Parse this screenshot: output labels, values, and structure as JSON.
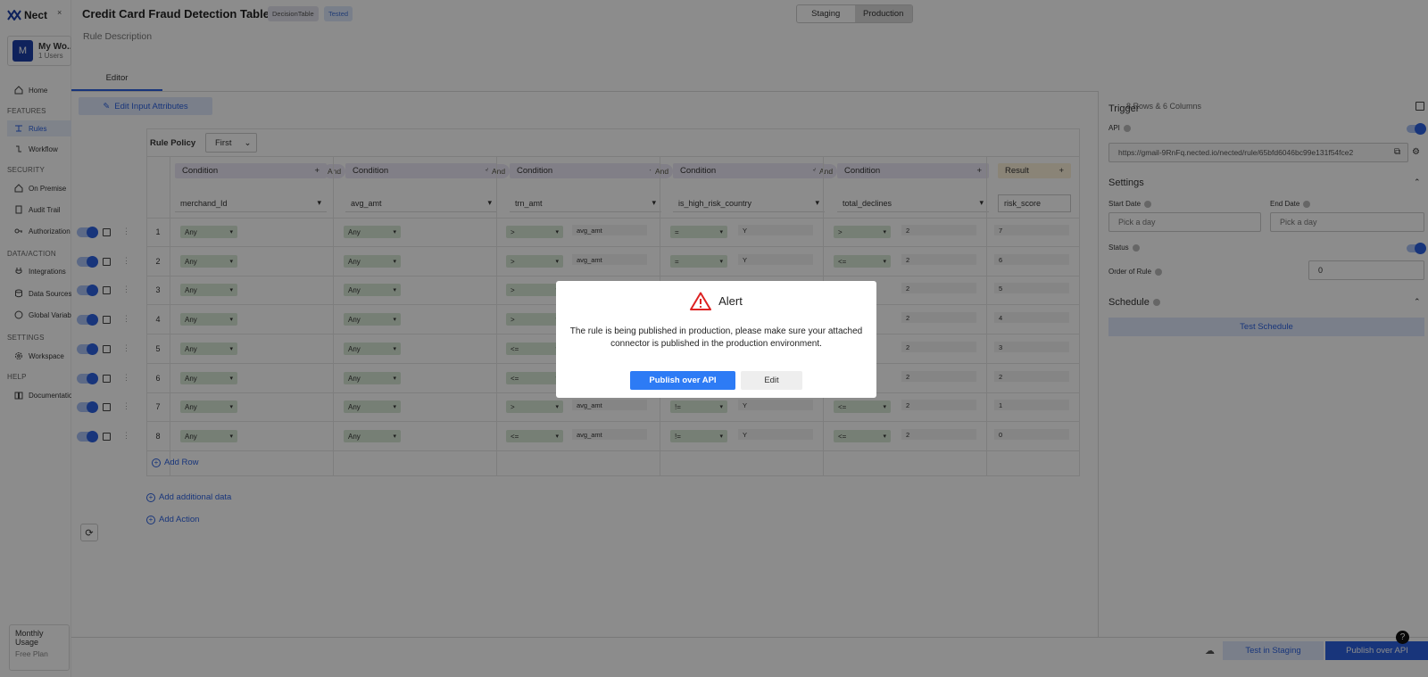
{
  "app": {
    "brand": "Nect",
    "close_tab": "×",
    "tab_mark": "ˆ"
  },
  "workspace": {
    "initial": "M",
    "name": "My Wo...",
    "users": "1 Users"
  },
  "sidebar": {
    "home": "Home",
    "sections": {
      "features": "FEATURES",
      "security": "SECURITY",
      "data_action": "DATA/ACTION",
      "settings": "SETTINGS",
      "help": "HELP"
    },
    "items": {
      "rules": "Rules",
      "workflow": "Workflow",
      "on_premise": "On Premise",
      "audit_trail": "Audit Trail",
      "authorization": "Authorization",
      "integrations": "Integrations",
      "data_sources": "Data Sources",
      "global_variables": "Global Variable",
      "workspace": "Workspace",
      "documentation": "Documentation"
    }
  },
  "usage": {
    "line1": "Monthly",
    "line2": "Usage",
    "plan": "Free Plan"
  },
  "header": {
    "title": "Credit Card Fraud Detection Table",
    "badge_type": "DecisionTable",
    "badge_status": "Tested",
    "description": "Rule Description",
    "env_staging": "Staging",
    "env_production": "Production"
  },
  "tabs": {
    "editor": "Editor"
  },
  "editor": {
    "edit_attrs": "Edit Input Attributes",
    "rule_policy_label": "Rule Policy",
    "rule_policy_value": "First",
    "condition_label": "Condition",
    "result_label": "Result",
    "and_label": "And",
    "plus": "+",
    "attributes": [
      "merchand_Id",
      "avg_amt",
      "trn_amt",
      "is_high_risk_country",
      "total_declines"
    ],
    "result_attr": "risk_score",
    "any": "Any",
    "avg_amt_val": "avg_amt",
    "rows": [
      {
        "n": "1",
        "op3": ">",
        "op4": "=",
        "v4": "Y",
        "op5": ">",
        "v5": "2",
        "r": "7"
      },
      {
        "n": "2",
        "op3": ">",
        "op4": "=",
        "v4": "Y",
        "op5": "<=",
        "v5": "2",
        "r": "6"
      },
      {
        "n": "3",
        "op3": ">",
        "op4": "",
        "v4": "",
        "op5": "",
        "v5": "2",
        "r": "5"
      },
      {
        "n": "4",
        "op3": ">",
        "op4": "",
        "v4": "",
        "op5": "",
        "v5": "2",
        "r": "4"
      },
      {
        "n": "5",
        "op3": "<=",
        "op4": "",
        "v4": "",
        "op5": "",
        "v5": "2",
        "r": "3"
      },
      {
        "n": "6",
        "op3": "<=",
        "op4": "",
        "v4": "",
        "op5": "",
        "v5": "2",
        "r": "2"
      },
      {
        "n": "7",
        "op3": ">",
        "op4": "!=",
        "v4": "Y",
        "op5": "<=",
        "v5": "2",
        "r": "1"
      },
      {
        "n": "8",
        "op3": "<=",
        "op4": "!=",
        "v4": "Y",
        "op5": "<=",
        "v5": "2",
        "r": "0"
      }
    ],
    "add_row": "Add Row",
    "add_additional": "Add additional data",
    "add_action": "Add Action"
  },
  "panel": {
    "rows_cols": "8 Rows & 6 Columns",
    "trigger": "Trigger",
    "api": "API",
    "url": "https://gmail-9RnFq.nected.io/nected/rule/65bfd6046bc99e131f54fce2",
    "settings": "Settings",
    "start_date": "Start Date",
    "end_date": "End Date",
    "pick_day": "Pick a day",
    "status": "Status",
    "order": "Order of Rule",
    "order_value": "0",
    "schedule": "Schedule",
    "test_schedule": "Test Schedule"
  },
  "footer": {
    "test_staging": "Test in Staging",
    "publish": "Publish over API",
    "help": "?"
  },
  "modal": {
    "title": "Alert",
    "message": "The rule is being published in production, please make sure your attached connector is published in the production environment.",
    "publish": "Publish over API",
    "edit": "Edit"
  }
}
